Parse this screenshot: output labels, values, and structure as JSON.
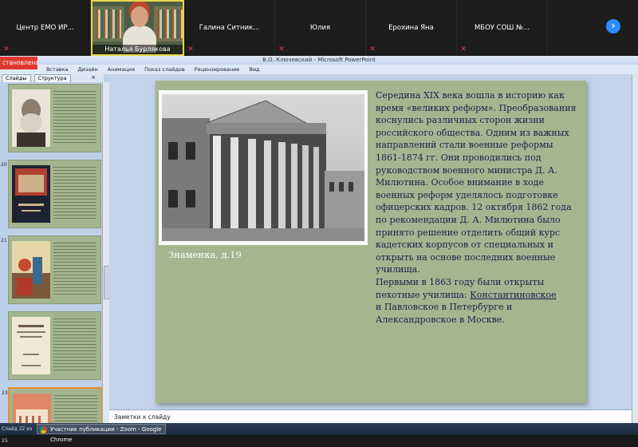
{
  "zoom": {
    "participants": [
      {
        "name": "Центр ЕМО ИР..."
      },
      {
        "name": "Наталья Бурлякова",
        "video": true
      },
      {
        "name": "Галина Ситник..."
      },
      {
        "name": "Юлия"
      },
      {
        "name": "Ерохина Яна"
      },
      {
        "name": "МБОУ СОШ №..."
      }
    ],
    "next_icon": "chevron-right-icon",
    "mute_icon": "mic-muted-icon",
    "colors": {
      "bar": "#1c1c1c",
      "active_speaker": "#e6d94a",
      "accent": "#2d8cff",
      "muted": "#e53b3b"
    }
  },
  "ppt": {
    "window_title": "В.О. Ключевский - Microsoft PowerPoint",
    "stop_share_label": "становлена",
    "ribbon_tabs": [
      "Вставка",
      "Дизайн",
      "Анимация",
      "Показ слайдов",
      "Рецензирование",
      "Вид"
    ],
    "panel_tabs": [
      "Слайды",
      "Структура"
    ],
    "panel_close": "×",
    "thumbnails": [
      {
        "num": ""
      },
      {
        "num": "20"
      },
      {
        "num": "21"
      },
      {
        "num": ""
      },
      {
        "num": "23"
      }
    ],
    "slide": {
      "caption": "Знаменка, д.19",
      "paragraphs": [
        "Середина XIX века вошла в историю как время «великих реформ». Преобразования коснулись различных сторон жизни российского общества. Одним из важных направлений стали военные реформы 1861-1874 гг. Они проводились под руководством военного министра Д. А. Милютина. Особое внимание в ходе военных реформ уделялось подготовке офицерских кадров. 12 октября 1862 года по рекомендации Д. А. Милютина было принято решение отделить общий курс кадетских корпусов от специальных и открыть на основе последних военные училища.",
        "Первыми в 1863 году были открыты пехотные училища: "
      ],
      "underlined": "Константиновское",
      "tail": "\nи Павловское в Петербурге и Александровское в Москве."
    },
    "notes_placeholder": "Заметки к слайду"
  },
  "taskbar": {
    "status": "Слайд 22 из 25",
    "app_item": "Участник публикации - Zoom - Google Chrome"
  }
}
